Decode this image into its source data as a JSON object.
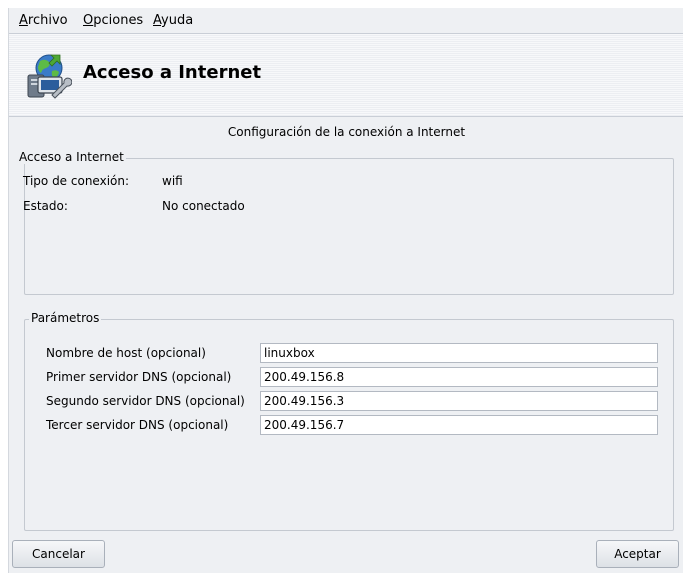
{
  "menubar": {
    "items": [
      {
        "mnemonic": "A",
        "rest": "rchivo"
      },
      {
        "mnemonic": "O",
        "rest": "pciones"
      },
      {
        "mnemonic": "A",
        "rest": "yuda"
      }
    ]
  },
  "header": {
    "title": "Acceso a Internet",
    "icon": "internet-access-icon"
  },
  "subtitle": "Configuración de la conexión a Internet",
  "access_group": {
    "title": "Acceso a Internet",
    "rows": [
      {
        "label": "Tipo de conexión:",
        "value": "wifi"
      },
      {
        "label": "Estado:",
        "value": "No conectado"
      }
    ]
  },
  "params_group": {
    "title": "Parámetros",
    "fields": [
      {
        "label": "Nombre de host (opcional)",
        "value": "linuxbox"
      },
      {
        "label": "Primer servidor DNS (opcional)",
        "value": "200.49.156.8"
      },
      {
        "label": "Segundo servidor DNS (opcional)",
        "value": "200.49.156.3"
      },
      {
        "label": "Tercer servidor DNS (opcional)",
        "value": "200.49.156.7"
      }
    ]
  },
  "buttons": {
    "cancel": "Cancelar",
    "accept": "Aceptar"
  }
}
